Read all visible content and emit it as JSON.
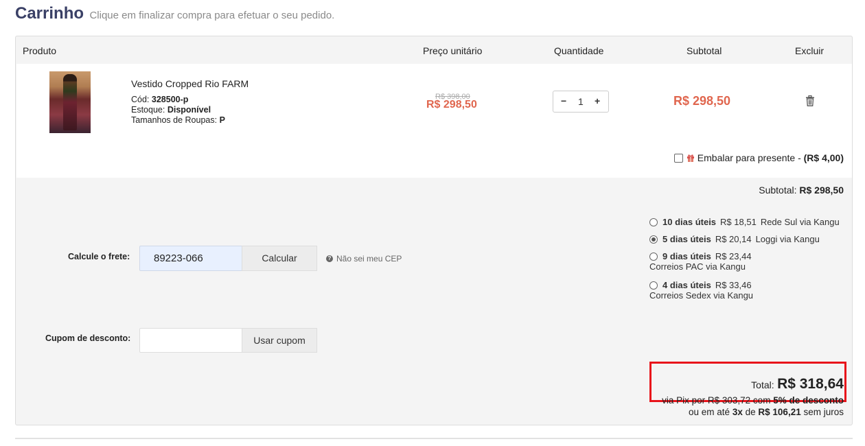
{
  "header": {
    "title": "Carrinho",
    "subtitle": "Clique em finalizar compra para efetuar o seu pedido."
  },
  "table": {
    "columns": {
      "product": "Produto",
      "unit_price": "Preço unitário",
      "quantity": "Quantidade",
      "subtotal": "Subtotal",
      "delete": "Excluir"
    }
  },
  "item": {
    "name": "Vestido Cropped Rio FARM",
    "code_label": "Cód:",
    "code": "328500-p",
    "stock_label": "Estoque:",
    "stock": "Disponível",
    "size_label": "Tamanhos de Roupas:",
    "size": "P",
    "old_price": "R$ 398,00",
    "price": "R$ 298,50",
    "quantity": "1",
    "minus": "−",
    "plus": "+",
    "subtotal": "R$ 298,50",
    "gift_label": "Embalar para presente -",
    "gift_price": "(R$ 4,00)"
  },
  "summary": {
    "subtotal_label": "Subtotal:",
    "subtotal": "R$ 298,50"
  },
  "shipping": {
    "options": [
      {
        "days": "10 dias úteis",
        "price": "R$ 18,51",
        "carrier": "Rede Sul via Kangu",
        "selected": false
      },
      {
        "days": "5 dias úteis",
        "price": "R$ 20,14",
        "carrier": "Loggi via Kangu",
        "selected": true
      },
      {
        "days": "9 dias úteis",
        "price": "R$ 23,44",
        "carrier": "Correios PAC via Kangu",
        "selected": false
      },
      {
        "days": "4 dias úteis",
        "price": "R$ 33,46",
        "carrier": "Correios Sedex via Kangu",
        "selected": false
      }
    ]
  },
  "freight": {
    "label": "Calcule o frete:",
    "cep": "89223-066",
    "button": "Calcular",
    "help": "Não sei meu CEP"
  },
  "coupon": {
    "label": "Cupom de desconto:",
    "value": "",
    "button": "Usar cupom"
  },
  "total": {
    "label": "Total:",
    "value": "R$ 318,64",
    "pix_prefix": "via Pix por R$ 303,72 com",
    "pix_discount": "5% de desconto",
    "installment_prefix": "ou em até",
    "installments": "3x",
    "installment_mid": "de",
    "installment_value": "R$ 106,21",
    "installment_suffix": "sem juros"
  },
  "colors": {
    "title": "#3a4066",
    "price": "#e0664e",
    "highlight": "#e8141b"
  }
}
